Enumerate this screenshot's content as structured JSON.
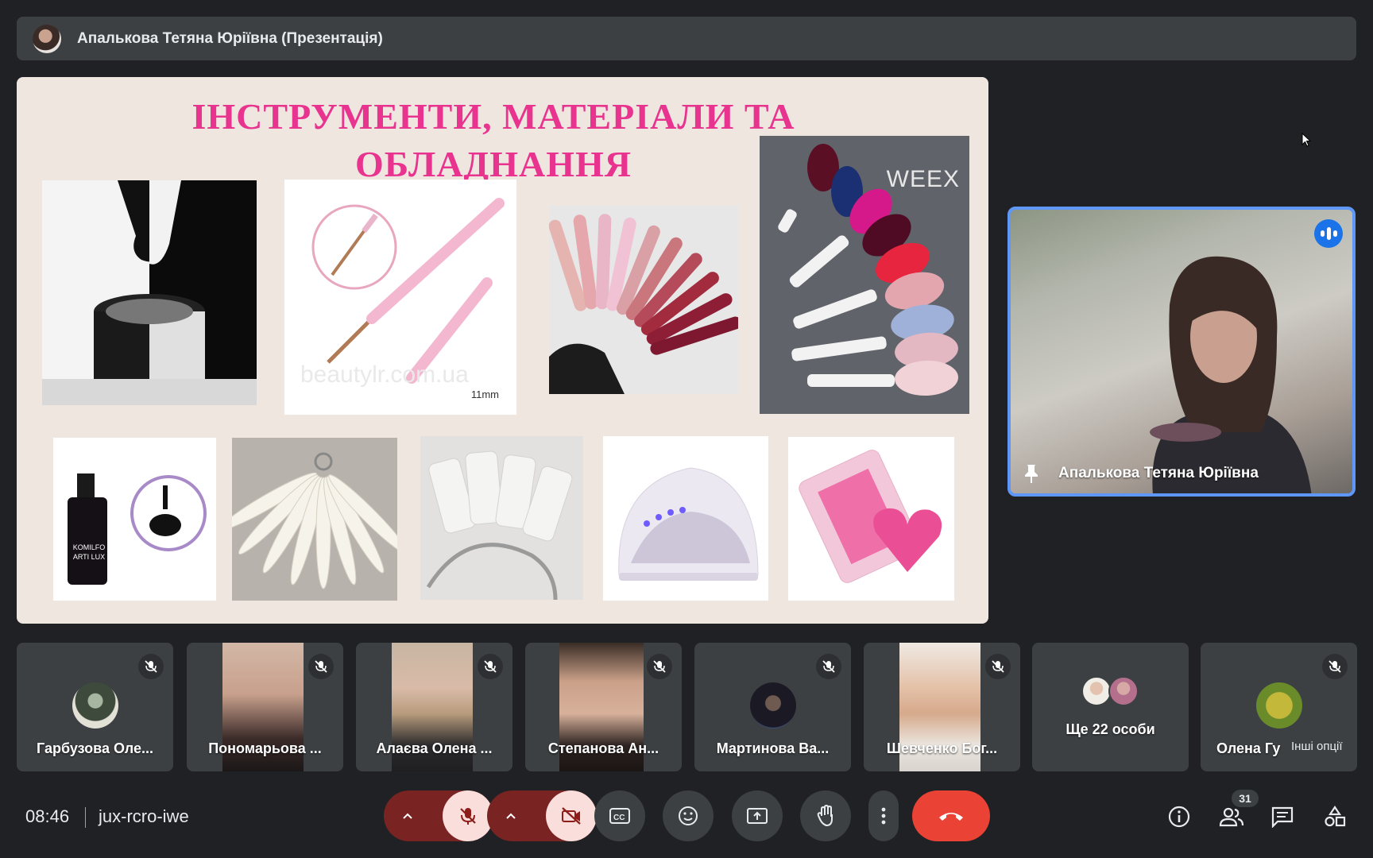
{
  "header": {
    "presenter_title": "Апалькова Тетяна Юріївна (Презентація)"
  },
  "slide": {
    "title_line1": "ІНСТРУМЕНТИ, МАТЕРІАЛИ ТА",
    "title_line2": "ОБЛАДНАННЯ",
    "images": [
      {
        "icon": "gel-polish-jar",
        "caption": ""
      },
      {
        "icon": "nail-art-brush",
        "caption": "11mm",
        "watermark": "beautylr.com.ua"
      },
      {
        "icon": "color-swatch-fan",
        "caption": ""
      },
      {
        "icon": "weex-gel-palette",
        "caption": "WEEX"
      },
      {
        "icon": "komilfo-bottle",
        "caption": "KOMILFO ARTI LUX"
      },
      {
        "icon": "nail-tip-fan",
        "caption": ""
      },
      {
        "icon": "nail-tips-ring",
        "caption": ""
      },
      {
        "icon": "uv-led-lamp",
        "caption": ""
      },
      {
        "icon": "pink-heart-sponge",
        "caption": ""
      }
    ]
  },
  "speaker": {
    "name": "Апалькова Тетяна Юріївна",
    "accent": "#5e97f6"
  },
  "participants": [
    {
      "name": "Гарбузова Оле...",
      "muted": true
    },
    {
      "name": "Пономарьова ...",
      "muted": true
    },
    {
      "name": "Алаєва Олена ...",
      "muted": true
    },
    {
      "name": "Степанова Ан...",
      "muted": true
    },
    {
      "name": "Мартинова Ва...",
      "muted": true
    },
    {
      "name": "Шевченко Бог...",
      "muted": true
    },
    {
      "name": "Ще 22 особи",
      "muted": false
    },
    {
      "name": "Олена Гу",
      "muted": true
    }
  ],
  "tooltip": "Інші опції",
  "bottombar": {
    "time": "08:46",
    "meeting_code": "jux-rcro-iwe",
    "people_count": "31",
    "end_color": "#ea4335"
  }
}
